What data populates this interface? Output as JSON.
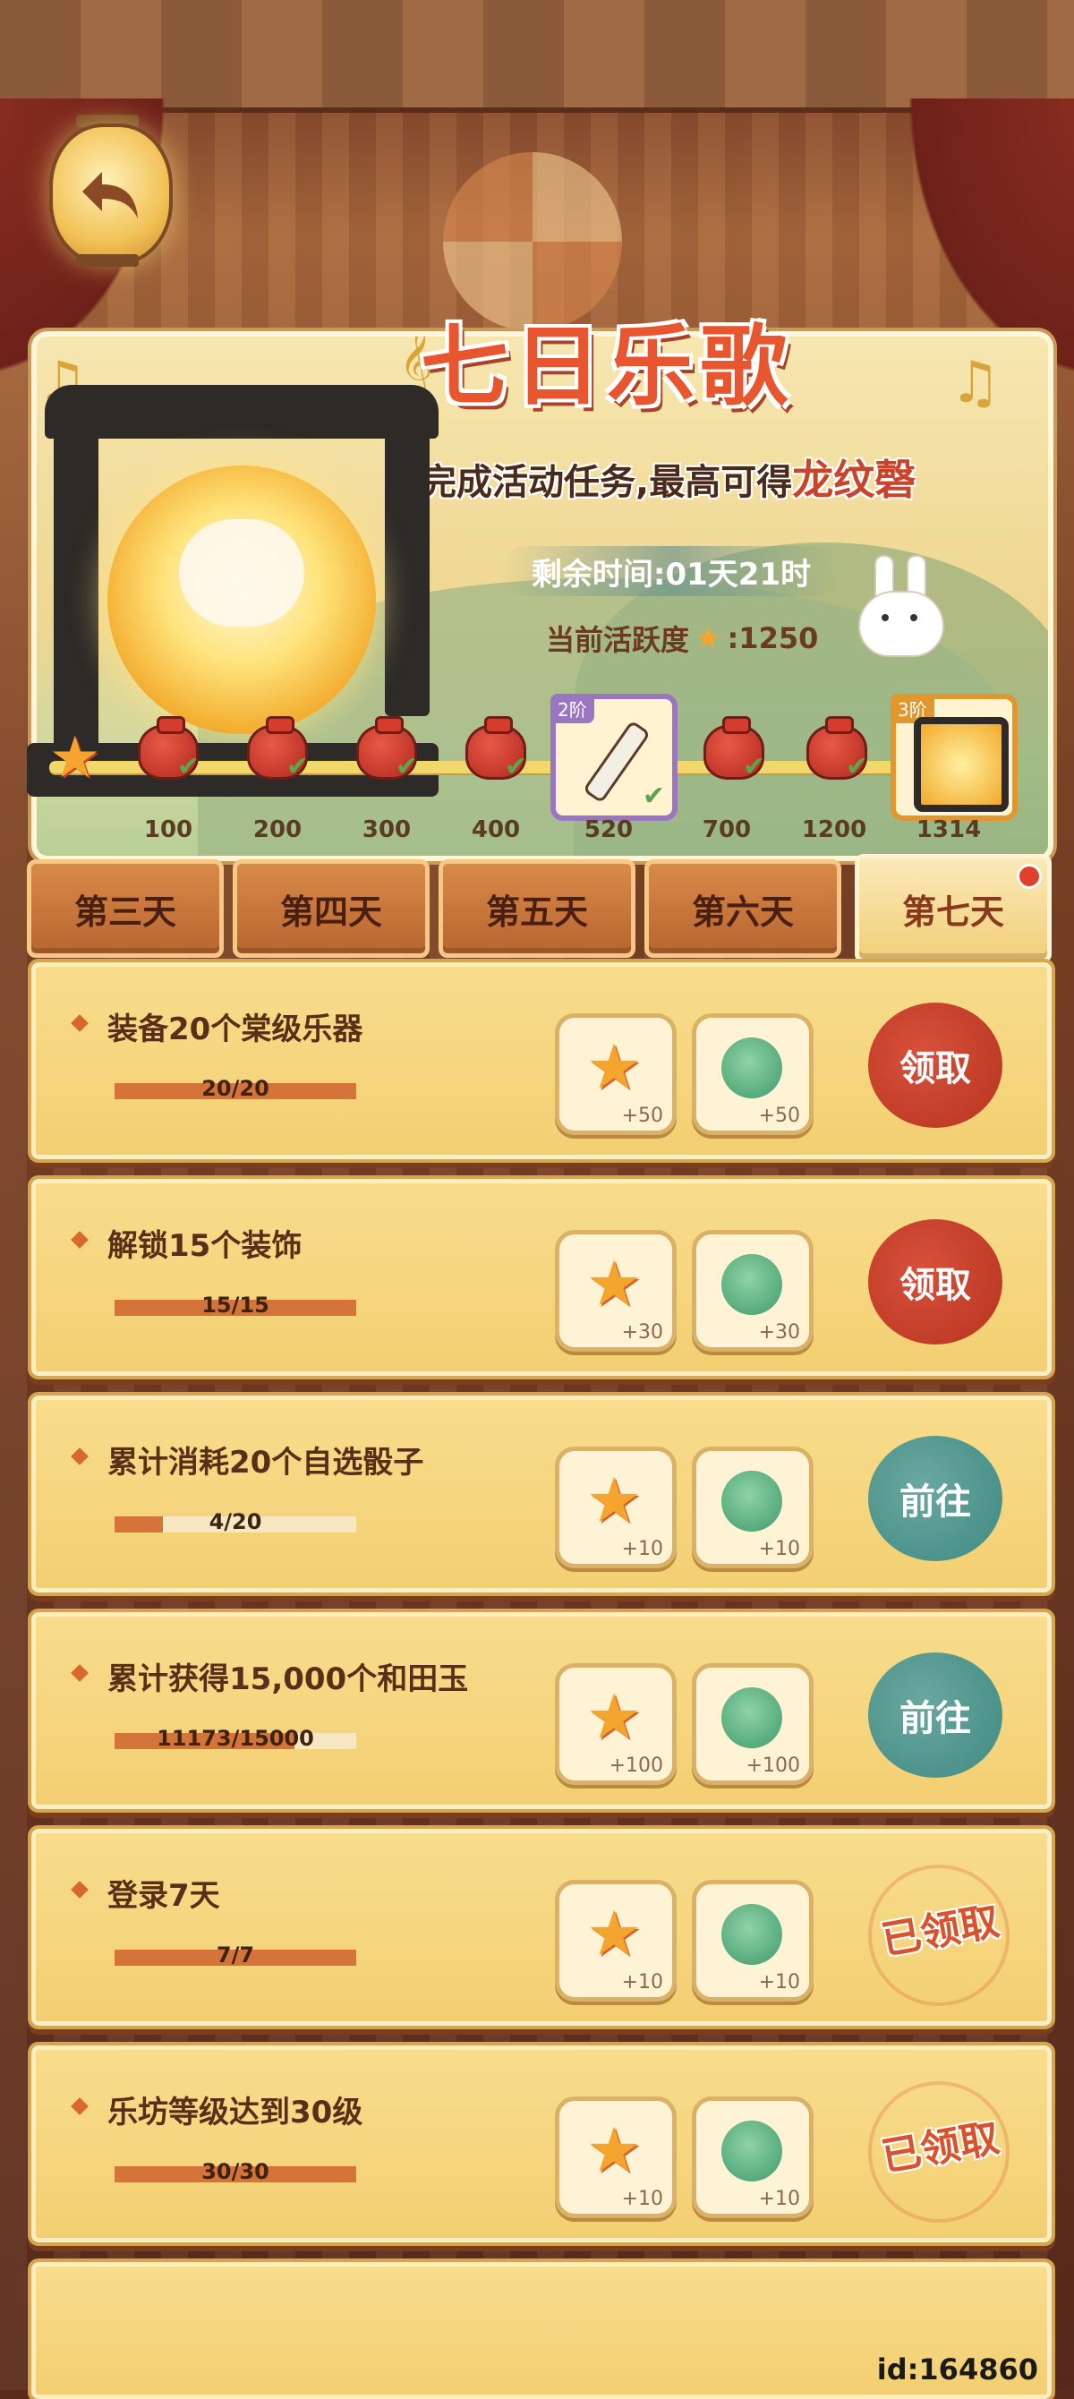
{
  "title": "七日乐歌",
  "subtitle_prefix": "完成活动任务,最高可得",
  "subtitle_highlight": "龙纹磬",
  "remaining_time": "剩余时间:01天21时",
  "activity_label": "当前活跃度",
  "activity_value": ":1250",
  "milestones": [
    "100",
    "200",
    "300",
    "400",
    "520",
    "700",
    "1200",
    "1314"
  ],
  "tier_520": "2阶",
  "tier_1314": "3阶",
  "tabs": [
    "第三天",
    "第四天",
    "第五天",
    "第六天",
    "第七天"
  ],
  "active_tab": "第七天",
  "tasks": [
    {
      "title": "装备20个棠级乐器",
      "progress": "20/20",
      "fraction": 1.0,
      "star": "+50",
      "jade": "+50",
      "action": "领取",
      "state": "claim"
    },
    {
      "title": "解锁15个装饰",
      "progress": "15/15",
      "fraction": 1.0,
      "star": "+30",
      "jade": "+30",
      "action": "领取",
      "state": "claim"
    },
    {
      "title": "累计消耗20个自选骰子",
      "progress": "4/20",
      "fraction": 0.2,
      "star": "+10",
      "jade": "+10",
      "action": "前往",
      "state": "goto"
    },
    {
      "title": "累计获得15,000个和田玉",
      "progress": "11173/15000",
      "fraction": 0.745,
      "star": "+100",
      "jade": "+100",
      "action": "前往",
      "state": "goto"
    },
    {
      "title": "登录7天",
      "progress": "7/7",
      "fraction": 1.0,
      "star": "+10",
      "jade": "+10",
      "action": "已领取",
      "state": "done"
    },
    {
      "title": "乐坊等级达到30级",
      "progress": "30/30",
      "fraction": 1.0,
      "star": "+10",
      "jade": "+10",
      "action": "已领取",
      "state": "done"
    }
  ],
  "footer_id": "id:164860",
  "colors": {
    "accent": "#e7562e",
    "claim": "#b53520",
    "goto": "#3f8a82",
    "bar": "#d5743a"
  }
}
